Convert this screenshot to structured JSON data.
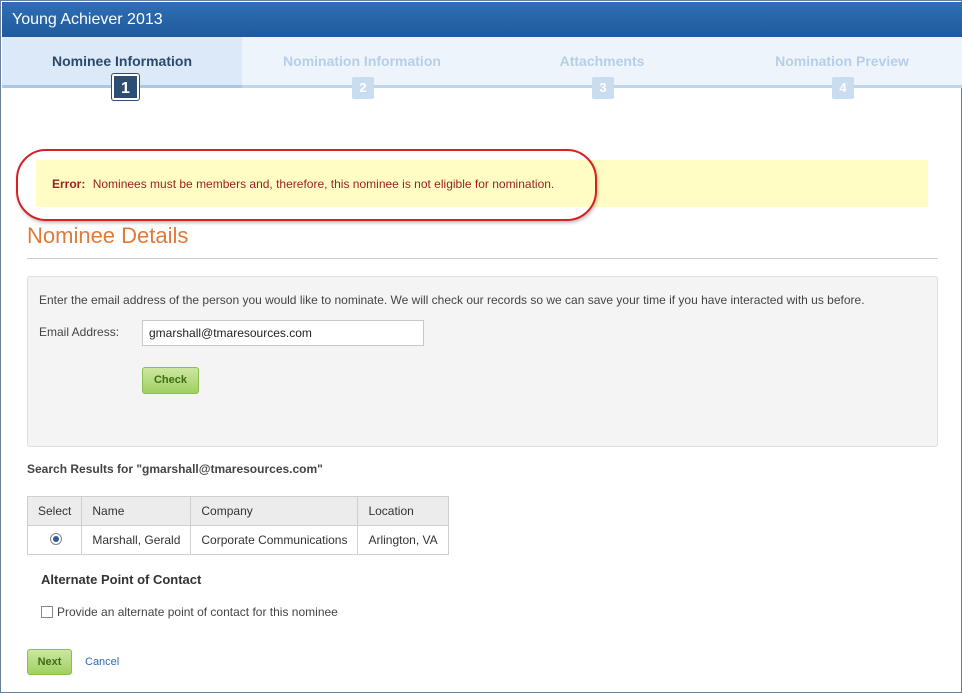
{
  "app": {
    "title": "Young Achiever 2013"
  },
  "steps": [
    {
      "label": "Nominee Information",
      "number": "1",
      "active": true
    },
    {
      "label": "Nomination Information",
      "number": "2",
      "active": false
    },
    {
      "label": "Attachments",
      "number": "3",
      "active": false
    },
    {
      "label": "Nomination Preview",
      "number": "4",
      "active": false
    }
  ],
  "error": {
    "prefix": "Error:",
    "message": "Nominees must be members and, therefore, this nominee is not eligible for nomination."
  },
  "section": {
    "title": "Nominee Details"
  },
  "form": {
    "intro": "Enter the email address of the person you would like to nominate. We will check our records so we can save your time if you have interacted with us before.",
    "email_label": "Email Address:",
    "email_value": "gmarshall@tmaresources.com",
    "check_label": "Check"
  },
  "results": {
    "title": "Search Results for \"gmarshall@tmaresources.com\"",
    "columns": [
      "Select",
      "Name",
      "Company",
      "Location"
    ],
    "rows": [
      {
        "selected": true,
        "name": "Marshall, Gerald",
        "company": "Corporate Communications",
        "location": "Arlington, VA"
      }
    ]
  },
  "alternate": {
    "title": "Alternate Point of Contact",
    "checkbox_label": "Provide an alternate point of contact for this nominee",
    "checked": false
  },
  "actions": {
    "next_label": "Next",
    "cancel_label": "Cancel"
  },
  "colors": {
    "header_blue": "#1f5a9c",
    "error_text": "#9b1f1f",
    "error_bg": "#fffdc4",
    "highlight_ring": "#d42222",
    "section_title": "#e07a3a",
    "button_green": "#9fd061",
    "link_blue": "#2a6fb2"
  }
}
